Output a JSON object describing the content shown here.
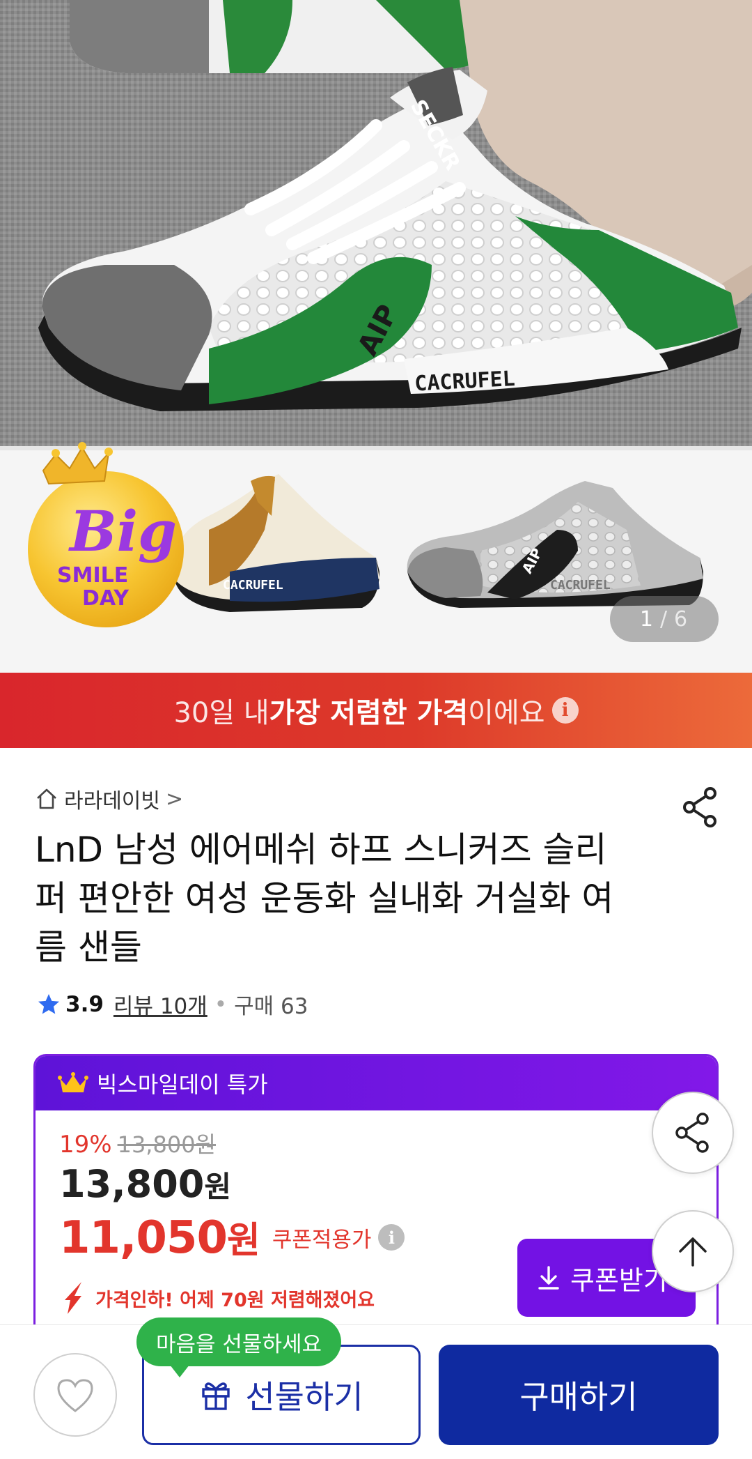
{
  "gallery": {
    "current": "1",
    "separator": "/",
    "total": "6",
    "badge_line1": "Big",
    "badge_line2": "SMILE",
    "badge_line3": "DAY",
    "hero_tongue_text": "SECKR",
    "hero_side_text": "CACRUFEL",
    "hero_logo_text": "AIP",
    "thumb_left_text": "CACRUFEL",
    "thumb_right_text": "CACRUFEL",
    "thumb_logo_text": "AIP"
  },
  "banner": {
    "prefix": "30일 내 ",
    "highlight": "가장 저렴한 가격",
    "suffix": "이에요",
    "info_icon": "i"
  },
  "product": {
    "store_name": "라라데이빗",
    "store_chevron": ">",
    "title": "LnD 남성 에어메쉬 하프 스니커즈 슬리퍼 편안한 여성 운동화 실내화 거실화 여름 샌들",
    "rating": "3.9",
    "reviews": "리뷰 10개",
    "separator": "•",
    "purchases": "구매 63"
  },
  "deal": {
    "header": "빅스마일데이 특가",
    "discount_pct": "19%",
    "original_price": "13,800원",
    "price_number": "13,800",
    "price_unit": "원",
    "coupon_price_number": "11,050",
    "coupon_price_unit": "원",
    "coupon_label": "쿠폰적용가",
    "coupon_info_icon": "i",
    "price_drop": "가격인하! 어제 70원 저렴해졌어요",
    "coupon_button": "쿠폰받기"
  },
  "bottom_bar": {
    "tooltip": "마음을 선물하세요",
    "gift_button": "선물하기",
    "buy_button": "구매하기"
  },
  "colors": {
    "banner_red": "#d9262c",
    "deal_purple": "#7312e4",
    "price_red": "#e2352c",
    "buy_blue": "#0f2aa0",
    "tooltip_green": "#2fb24a"
  }
}
